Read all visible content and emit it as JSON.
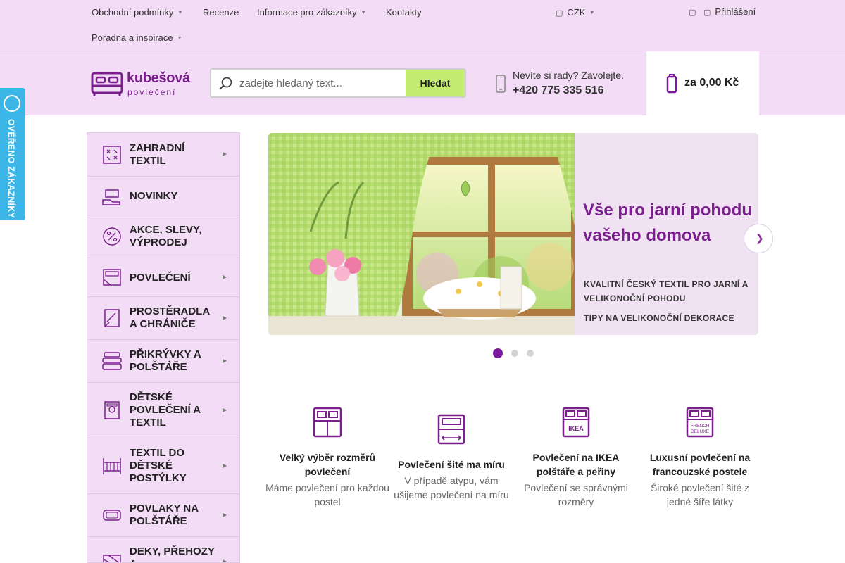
{
  "topnav": {
    "items": [
      {
        "label": "Obchodní podmínky",
        "has_dropdown": true
      },
      {
        "label": "Recenze",
        "has_dropdown": false
      },
      {
        "label": "Informace pro zákazníky",
        "has_dropdown": true
      },
      {
        "label": "Kontakty",
        "has_dropdown": false
      },
      {
        "label": "Poradna a inspirace",
        "has_dropdown": true
      }
    ],
    "currency": "CZK",
    "login": "Přihlášení"
  },
  "header": {
    "logo_name": "kubešová",
    "logo_sub": "povlečení",
    "search_placeholder": "zadejte hledaný text...",
    "search_button": "Hledat",
    "help_question": "Nevíte si rady? Zavolejte.",
    "help_phone": "+420 775 335 516",
    "cart_total": "za 0,00 Kč"
  },
  "verified": {
    "label": "OVĚŘENO ZÁKAZNÍKY"
  },
  "sidebar": {
    "categories": [
      {
        "label": "ZAHRADNÍ TEXTIL",
        "icon": "garden-textile-icon"
      },
      {
        "label": "NOVINKY",
        "icon": "new-items-icon"
      },
      {
        "label": "AKCE, SLEVY, VÝPRODEJ",
        "icon": "discount-icon"
      },
      {
        "label": "POVLEČENÍ",
        "icon": "bedding-icon"
      },
      {
        "label": "PROSTĚRADLA A CHRÁNIČE",
        "icon": "sheet-icon"
      },
      {
        "label": "PŘIKRÝVKY A POLŠTÁŘE",
        "icon": "duvet-stack-icon"
      },
      {
        "label": "DĚTSKÉ POVLEČENÍ A TEXTIL",
        "icon": "kids-bedding-icon"
      },
      {
        "label": "TEXTIL DO DĚTSKÉ POSTÝLKY",
        "icon": "crib-icon"
      },
      {
        "label": "POVLAKY NA POLŠTÁŘE",
        "icon": "pillowcase-icon"
      },
      {
        "label": "DEKY, PŘEHOZY A",
        "icon": "blanket-icon"
      }
    ]
  },
  "banner": {
    "headline": "Vše pro jarní pohodu vašeho domova",
    "subline": "KVALITNÍ ČESKÝ TEXTIL PRO JARNÍ A VELIKONOČNÍ POHODU",
    "link": "TIPY NA VELIKONOČNÍ DEKORACE",
    "slide_count": 3,
    "active_slide": 1
  },
  "features": [
    {
      "title": "Velký výběr rozměrů povlečení",
      "desc": "Máme povlečení pro každou postel",
      "icon": "double-bed-icon"
    },
    {
      "title": "Povlečení šité ma míru",
      "desc": "V případě atypu, vám ušijeme povlečení na míru",
      "icon": "custom-size-bed-icon"
    },
    {
      "title": "Povlečení na IKEA polštáře a peřiny",
      "desc": "Povlečení se správnými rozměry",
      "icon": "ikea-bed-icon",
      "icon_text": "IKEA"
    },
    {
      "title": "Luxusní povlečení na francouzské postele",
      "desc": "Široké povlečení šité z jedné šíře látky",
      "icon": "french-bed-icon",
      "icon_text": "FRENCH DELUXE"
    }
  ],
  "colors": {
    "header_bg": "#f3dcf5",
    "brand_purple": "#7b1f8e",
    "search_button": "#c4ec72",
    "verified_blue": "#3cb6e7",
    "active_dot": "#7b1aa0"
  }
}
